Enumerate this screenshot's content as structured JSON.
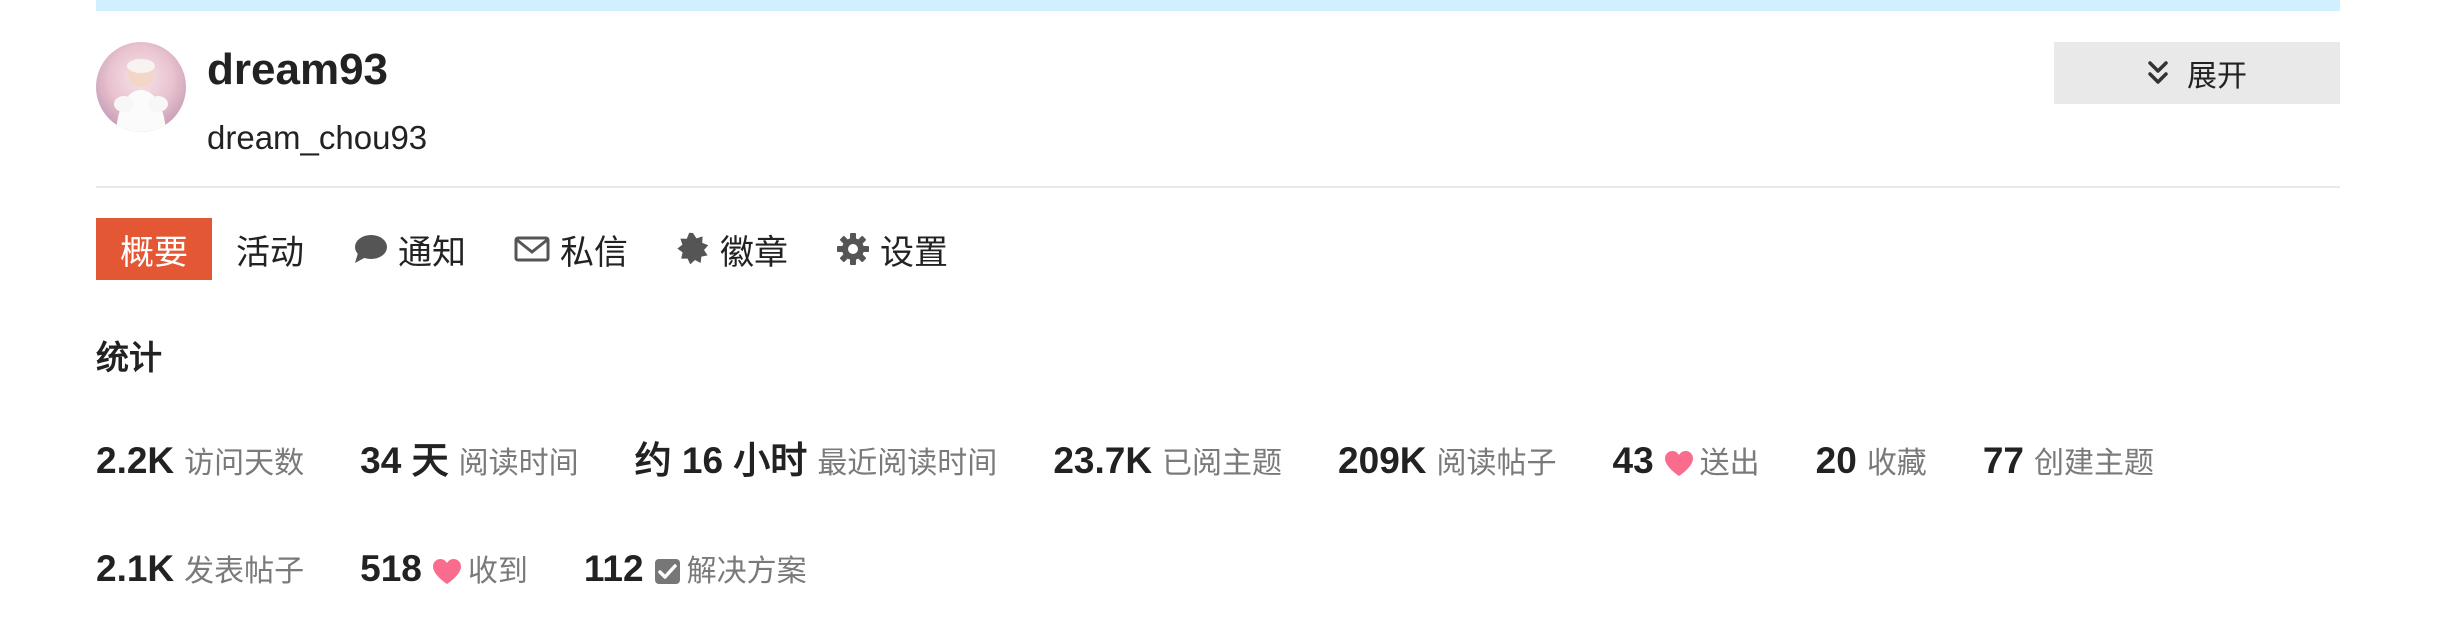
{
  "header": {
    "username": "dream93",
    "full_name": "dream_chou93",
    "expand_label": "展开",
    "avatar_icon": "avatar-photo",
    "expand_icon": "double-chevron-down-icon"
  },
  "nav": {
    "items": [
      {
        "label": "概要",
        "icon": "",
        "active": true
      },
      {
        "label": "活动",
        "icon": ""
      },
      {
        "label": "通知",
        "icon": "comment-icon"
      },
      {
        "label": "私信",
        "icon": "envelope-icon"
      },
      {
        "label": "徽章",
        "icon": "badge-icon"
      },
      {
        "label": "设置",
        "icon": "gear-icon"
      }
    ]
  },
  "stats": {
    "title": "统计",
    "row1": [
      {
        "value": "2.2K",
        "label": "访问天数"
      },
      {
        "value": "34 天",
        "label": "阅读时间"
      },
      {
        "value": "约 16 小时",
        "label": "最近阅读时间"
      },
      {
        "value": "23.7K",
        "label": "已阅主题"
      },
      {
        "value": "209K",
        "label": "阅读帖子"
      },
      {
        "value": "43",
        "label": "送出",
        "icon": "heart-icon"
      },
      {
        "value": "20",
        "label": "收藏"
      },
      {
        "value": "77",
        "label": "创建主题"
      }
    ],
    "row2": [
      {
        "value": "2.1K",
        "label": "发表帖子"
      },
      {
        "value": "518",
        "label": "收到",
        "icon": "heart-icon"
      },
      {
        "value": "112",
        "label": "解决方案",
        "icon": "checkbox-icon"
      }
    ]
  },
  "colors": {
    "accent": "#e45735",
    "heart": "#fa6c8d",
    "top_bar": "#d1f0ff",
    "muted_text": "#7a7a7a",
    "button_bg": "#e9e9e9"
  }
}
